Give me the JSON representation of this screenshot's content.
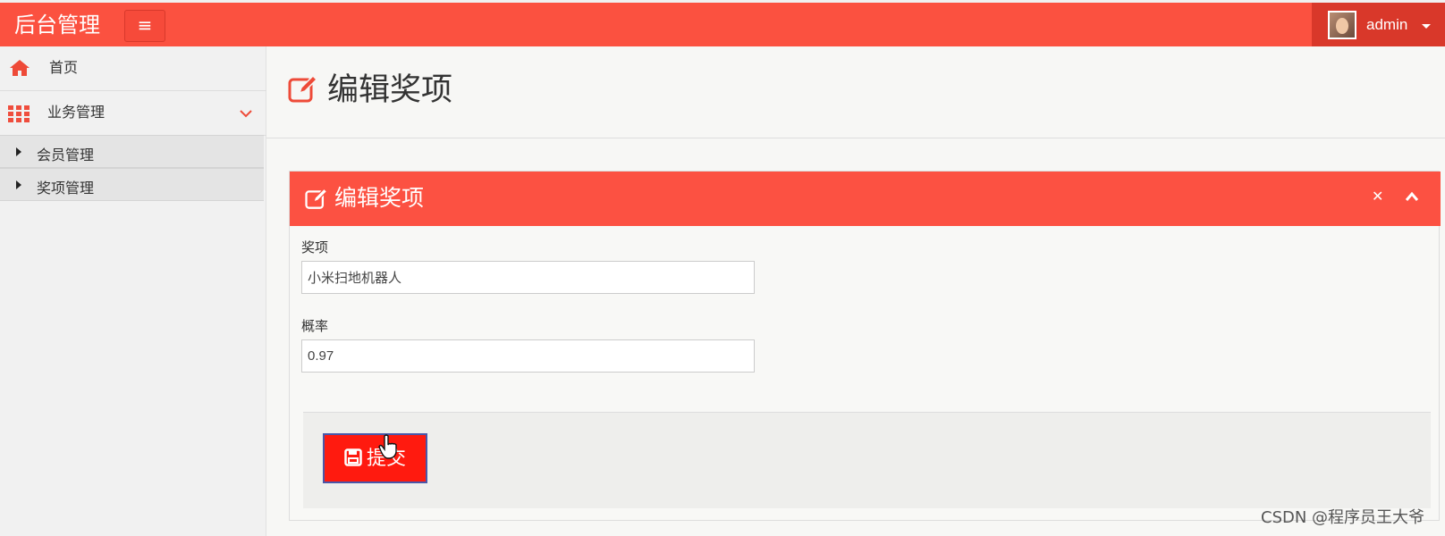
{
  "header": {
    "brand": "后台管理",
    "menu_toggle_icon": "hamburger-icon",
    "user": {
      "name": "admin",
      "avatar_icon": "user-avatar"
    }
  },
  "sidebar": {
    "items": [
      {
        "label": "首页",
        "icon": "home-icon"
      },
      {
        "label": "业务管理",
        "icon": "grid-icon",
        "expanded": true,
        "children": [
          {
            "label": "会员管理"
          },
          {
            "label": "奖项管理"
          }
        ]
      }
    ]
  },
  "page": {
    "title": "编辑奖项",
    "title_icon": "edit-icon"
  },
  "panel": {
    "title": "编辑奖项",
    "icons": [
      "edit-icon",
      "close-icon",
      "collapse-icon"
    ]
  },
  "form": {
    "fields": [
      {
        "label": "奖项",
        "value": "小米扫地机器人"
      },
      {
        "label": "概率",
        "value": "0.97"
      }
    ],
    "submit_label": "提交",
    "submit_icon": "save-icon"
  },
  "colors": {
    "primary": "#fb5140",
    "user_area": "#d9382a",
    "submit": "#ff1a0f",
    "sidebar": "#f1f1f1"
  },
  "watermark": "CSDN @程序员王大爷"
}
